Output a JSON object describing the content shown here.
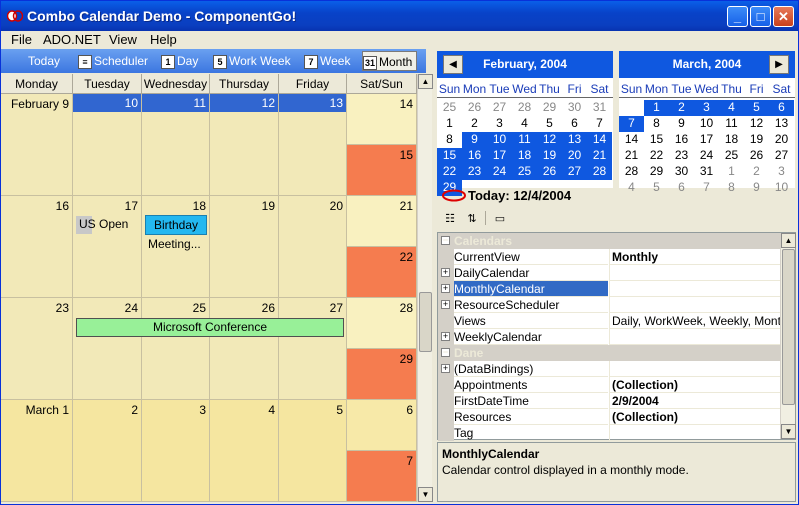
{
  "window": {
    "title": "Combo Calendar Demo - ComponentGo!"
  },
  "menu": [
    "File",
    "ADO.NET",
    "View",
    "Help"
  ],
  "toolbar": {
    "today": "Today",
    "scheduler": "Scheduler",
    "day": "Day",
    "workweek": "Work Week",
    "week": "Week",
    "month": "Month"
  },
  "calendar": {
    "day_headers": [
      "Monday",
      "Tuesday",
      "Wednesday",
      "Thursday",
      "Friday",
      "Sat/Sun"
    ],
    "weeks": [
      {
        "days": [
          "February 9",
          "10",
          "11",
          "12",
          "13",
          "14"
        ],
        "sun": "15"
      },
      {
        "days": [
          "16",
          "17",
          "18",
          "19",
          "20",
          "21"
        ],
        "sun": "22"
      },
      {
        "days": [
          "23",
          "24",
          "25",
          "26",
          "27",
          "28"
        ],
        "sun": "29"
      },
      {
        "days": [
          "March 1",
          "2",
          "3",
          "4",
          "5",
          "6"
        ],
        "sun": "7"
      }
    ],
    "events": {
      "us_open": "US Open",
      "birthday": "Birthday",
      "meeting": "Meeting...",
      "conference": "Microsoft Conference"
    },
    "colors": {
      "selected_header": "#3166d0",
      "weekend": "#f57c4f",
      "cell": "#fbf4c8",
      "event_green": "#98f098",
      "event_blue": "#24b8f0"
    }
  },
  "mini_feb": {
    "title": "February, 2004",
    "dows": [
      "Sun",
      "Mon",
      "Tue",
      "Wed",
      "Thu",
      "Fri",
      "Sat"
    ],
    "rows": [
      [
        "25",
        "26",
        "27",
        "28",
        "29",
        "30",
        "31"
      ],
      [
        "1",
        "2",
        "3",
        "4",
        "5",
        "6",
        "7"
      ],
      [
        "8",
        "9",
        "10",
        "11",
        "12",
        "13",
        "14"
      ],
      [
        "15",
        "16",
        "17",
        "18",
        "19",
        "20",
        "21"
      ],
      [
        "22",
        "23",
        "24",
        "25",
        "26",
        "27",
        "28"
      ],
      [
        "29",
        "",
        "",
        "",
        "",
        "",
        ""
      ]
    ]
  },
  "mini_mar": {
    "title": "March, 2004",
    "dows": [
      "Sun",
      "Mon",
      "Tue",
      "Wed",
      "Thu",
      "Fri",
      "Sat"
    ],
    "rows": [
      [
        "",
        "1",
        "2",
        "3",
        "4",
        "5",
        "6"
      ],
      [
        "7",
        "8",
        "9",
        "10",
        "11",
        "12",
        "13"
      ],
      [
        "14",
        "15",
        "16",
        "17",
        "18",
        "19",
        "20"
      ],
      [
        "21",
        "22",
        "23",
        "24",
        "25",
        "26",
        "27"
      ],
      [
        "28",
        "29",
        "30",
        "31",
        "1",
        "2",
        "3"
      ],
      [
        "4",
        "5",
        "6",
        "7",
        "8",
        "9",
        "10"
      ]
    ]
  },
  "today_label": "Today: 12/4/2004",
  "property_grid": {
    "rows": [
      {
        "type": "cat",
        "name": "Calendars",
        "value": ""
      },
      {
        "type": "prop",
        "name": "CurrentView",
        "value": "Monthly",
        "bold": true
      },
      {
        "type": "exp",
        "name": "DailyCalendar",
        "value": ""
      },
      {
        "type": "exp",
        "name": "MonthlyCalendar",
        "value": "",
        "selected": true
      },
      {
        "type": "exp",
        "name": "ResourceScheduler",
        "value": ""
      },
      {
        "type": "prop",
        "name": "Views",
        "value": "Daily, WorkWeek, Weekly, Monthly"
      },
      {
        "type": "exp",
        "name": "WeeklyCalendar",
        "value": ""
      },
      {
        "type": "cat",
        "name": "Dane",
        "value": ""
      },
      {
        "type": "exp",
        "name": "(DataBindings)",
        "value": ""
      },
      {
        "type": "prop",
        "name": "Appointments",
        "value": "(Collection)",
        "bold": true
      },
      {
        "type": "prop",
        "name": "FirstDateTime",
        "value": "2/9/2004",
        "bold": true
      },
      {
        "type": "prop",
        "name": "Resources",
        "value": "(Collection)",
        "bold": true
      },
      {
        "type": "prop",
        "name": "Tag",
        "value": ""
      }
    ]
  },
  "description": {
    "title": "MonthlyCalendar",
    "text": "Calendar control displayed in a monthly mode."
  }
}
